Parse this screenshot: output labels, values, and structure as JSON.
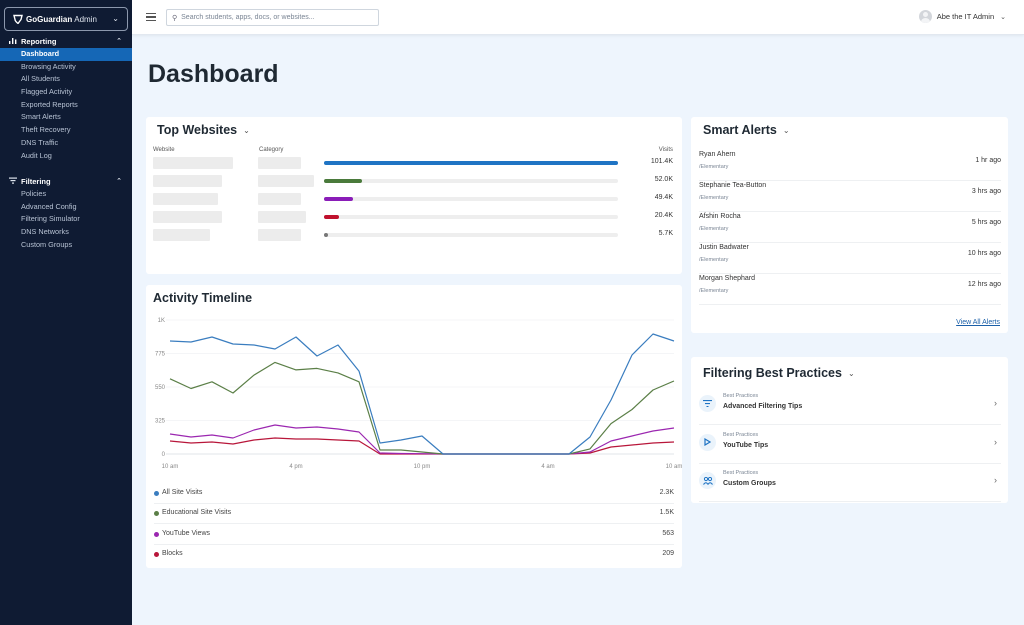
{
  "app": {
    "brand_bold": "GoGuardian",
    "brand_rest": "Admin"
  },
  "sidebar": {
    "sections": [
      {
        "label": "Reporting",
        "icon": "bar-chart-icon",
        "items": [
          {
            "label": "Dashboard",
            "active": true
          },
          {
            "label": "Browsing Activity"
          },
          {
            "label": "All Students"
          },
          {
            "label": "Flagged Activity"
          },
          {
            "label": "Exported Reports"
          },
          {
            "label": "Smart Alerts"
          },
          {
            "label": "Theft Recovery"
          },
          {
            "label": "DNS Traffic"
          },
          {
            "label": "Audit Log"
          }
        ]
      },
      {
        "label": "Filtering",
        "icon": "filter-icon",
        "items": [
          {
            "label": "Policies"
          },
          {
            "label": "Advanced Config"
          },
          {
            "label": "Filtering Simulator"
          },
          {
            "label": "DNS Networks"
          },
          {
            "label": "Custom Groups"
          }
        ]
      }
    ]
  },
  "topbar": {
    "search_placeholder": "Search students, apps, docs, or websites...",
    "user_name": "Abe the IT Admin"
  },
  "page": {
    "title": "Dashboard"
  },
  "top_websites": {
    "title": "Top Websites",
    "headers": {
      "website": "Website",
      "category": "Category",
      "visits": "Visits"
    },
    "rows": [
      {
        "visits": "101.4K",
        "fraction": 1.0,
        "color": "#1f74c4"
      },
      {
        "visits": "52.0K",
        "fraction": 0.13,
        "color": "#4a7a3b"
      },
      {
        "visits": "49.4K",
        "fraction": 0.1,
        "color": "#8a1db8"
      },
      {
        "visits": "20.4K",
        "fraction": 0.05,
        "color": "#c0112e"
      },
      {
        "visits": "5.7K",
        "fraction": 0.01,
        "color": "#777777"
      }
    ]
  },
  "smart_alerts": {
    "title": "Smart Alerts",
    "items": [
      {
        "name": "Ryan Ahern",
        "group": "/Elementary",
        "time": "1 hr ago"
      },
      {
        "name": "Stephanie Tea-Button",
        "group": "/Elementary",
        "time": "3 hrs ago"
      },
      {
        "name": "Afshin Rocha",
        "group": "/Elementary",
        "time": "5 hrs ago"
      },
      {
        "name": "Justin Badwater",
        "group": "/Elementary",
        "time": "10 hrs ago"
      },
      {
        "name": "Morgan Shephard",
        "group": "/Elementary",
        "time": "12 hrs ago"
      }
    ],
    "view_all": "View All Alerts"
  },
  "best_practices": {
    "title": "Filtering Best Practices",
    "items": [
      {
        "kicker": "Best Practices",
        "title": "Advanced Filtering Tips",
        "icon": "filter-icon"
      },
      {
        "kicker": "Best Practices",
        "title": "YouTube Tips",
        "icon": "play-icon"
      },
      {
        "kicker": "Best Practices",
        "title": "Custom Groups",
        "icon": "groups-icon"
      }
    ]
  },
  "activity_timeline": {
    "title": "Activity Timeline",
    "legend": [
      {
        "label": "All Site Visits",
        "total": "2.3K",
        "color": "#3a7dbf"
      },
      {
        "label": "Educational Site Visits",
        "total": "1.5K",
        "color": "#5b7f47"
      },
      {
        "label": "YouTube Views",
        "total": "563",
        "color": "#9b27b0"
      },
      {
        "label": "Blocks",
        "total": "209",
        "color": "#b8163a"
      }
    ]
  },
  "chart_data": {
    "type": "line",
    "title": "Activity Timeline",
    "xlabel": "",
    "ylabel": "",
    "x_tick_labels": [
      "10 am",
      "4 pm",
      "10 pm",
      "4 am",
      "10 am"
    ],
    "x_tick_indices": [
      0,
      6,
      12,
      18,
      24
    ],
    "y_ticks": [
      0,
      325,
      550,
      775,
      1000
    ],
    "y_tick_labels": [
      "0",
      "325",
      "550",
      "775",
      "1K"
    ],
    "ylim": [
      0,
      1000
    ],
    "grid": true,
    "legend_position": "bottom",
    "x": [
      "10 am",
      "11 am",
      "12 pm",
      "1 pm",
      "2 pm",
      "3 pm",
      "4 pm",
      "5 pm",
      "6 pm",
      "7 pm",
      "8 pm",
      "9 pm",
      "10 pm",
      "11 pm",
      "12 am",
      "1 am",
      "2 am",
      "3 am",
      "4 am",
      "5 am",
      "6 am",
      "7 am",
      "8 am",
      "9 am",
      "10 am"
    ],
    "series": [
      {
        "name": "All Site Visits",
        "values": [
          859,
          852,
          886,
          839,
          832,
          805,
          886,
          758,
          832,
          657,
          107,
          136,
          175,
          0,
          0,
          0,
          0,
          0,
          0,
          0,
          165,
          463,
          765,
          906,
          859
        ]
      },
      {
        "name": "Educational Site Visits",
        "values": [
          605,
          540,
          585,
          510,
          630,
          715,
          665,
          675,
          645,
          585,
          39,
          39,
          19,
          0,
          0,
          0,
          0,
          0,
          0,
          0,
          49,
          295,
          399,
          530,
          590
        ]
      },
      {
        "name": "YouTube Views",
        "values": [
          194,
          165,
          184,
          155,
          233,
          281,
          252,
          262,
          243,
          213,
          10,
          5,
          3,
          0,
          0,
          0,
          0,
          0,
          0,
          0,
          19,
          126,
          175,
          223,
          252
        ]
      },
      {
        "name": "Blocks",
        "values": [
          126,
          107,
          116,
          97,
          136,
          155,
          146,
          146,
          136,
          126,
          0,
          0,
          0,
          0,
          0,
          0,
          0,
          0,
          0,
          0,
          10,
          68,
          87,
          107,
          116
        ]
      }
    ]
  }
}
